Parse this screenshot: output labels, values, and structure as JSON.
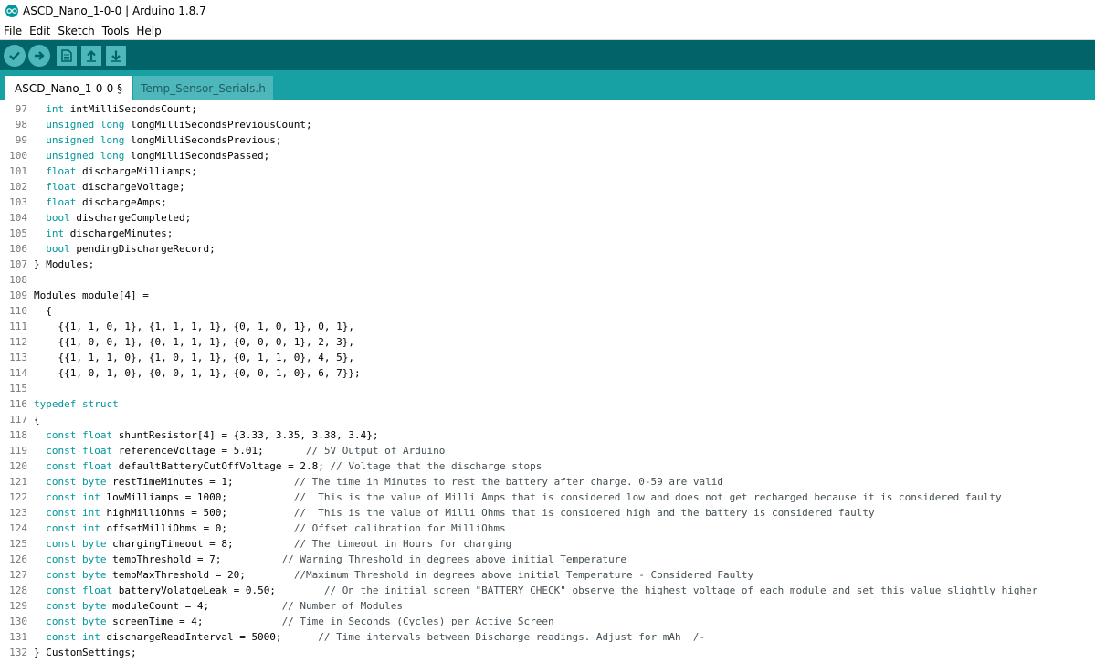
{
  "window": {
    "title": "ASCD_Nano_1-0-0 | Arduino 1.8.7"
  },
  "menu": [
    "File",
    "Edit",
    "Sketch",
    "Tools",
    "Help"
  ],
  "toolbar": [
    {
      "name": "verify-button",
      "icon": "check-icon"
    },
    {
      "name": "upload-button",
      "icon": "arrow-right-icon"
    },
    {
      "name": "new-button",
      "icon": "document-icon"
    },
    {
      "name": "open-button",
      "icon": "arrow-up-icon"
    },
    {
      "name": "save-button",
      "icon": "arrow-down-icon"
    }
  ],
  "tabs": [
    {
      "label": "ASCD_Nano_1-0-0 §",
      "active": true
    },
    {
      "label": "Temp_Sensor_Serials.h",
      "active": false
    }
  ],
  "colors": {
    "toolbar_bg": "#006468",
    "tabbar_bg": "#17a1a5",
    "keyword": "#00979c",
    "comment": "#434f54"
  },
  "code": [
    {
      "n": "97",
      "code": "  int intMilliSecondsCount;"
    },
    {
      "n": "98",
      "code": "  unsigned long longMilliSecondsPreviousCount;"
    },
    {
      "n": "99",
      "code": "  unsigned long longMilliSecondsPrevious;"
    },
    {
      "n": "100",
      "code": "  unsigned long longMilliSecondsPassed;"
    },
    {
      "n": "101",
      "code": "  float dischargeMilliamps;"
    },
    {
      "n": "102",
      "code": "  float dischargeVoltage;"
    },
    {
      "n": "103",
      "code": "  float dischargeAmps;"
    },
    {
      "n": "104",
      "code": "  bool dischargeCompleted;"
    },
    {
      "n": "105",
      "code": "  int dischargeMinutes;"
    },
    {
      "n": "106",
      "code": "  bool pendingDischargeRecord;"
    },
    {
      "n": "107",
      "code": "} Modules;"
    },
    {
      "n": "108",
      "code": ""
    },
    {
      "n": "109",
      "code": "Modules module[4] ="
    },
    {
      "n": "110",
      "code": "  {"
    },
    {
      "n": "111",
      "code": "    {{1, 1, 0, 1}, {1, 1, 1, 1}, {0, 1, 0, 1}, 0, 1},"
    },
    {
      "n": "112",
      "code": "    {{1, 0, 0, 1}, {0, 1, 1, 1}, {0, 0, 0, 1}, 2, 3},"
    },
    {
      "n": "113",
      "code": "    {{1, 1, 1, 0}, {1, 0, 1, 1}, {0, 1, 1, 0}, 4, 5},"
    },
    {
      "n": "114",
      "code": "    {{1, 0, 1, 0}, {0, 0, 1, 1}, {0, 0, 1, 0}, 6, 7}};"
    },
    {
      "n": "115",
      "code": ""
    },
    {
      "n": "116",
      "code": "typedef struct"
    },
    {
      "n": "117",
      "code": "{"
    },
    {
      "n": "118",
      "code": "  const float shuntResistor[4] = {3.33, 3.35, 3.38, 3.4};"
    },
    {
      "n": "119",
      "code": "  const float referenceVoltage = 5.01;       // 5V Output of Arduino"
    },
    {
      "n": "120",
      "code": "  const float defaultBatteryCutOffVoltage = 2.8; // Voltage that the discharge stops"
    },
    {
      "n": "121",
      "code": "  const byte restTimeMinutes = 1;          // The time in Minutes to rest the battery after charge. 0-59 are valid"
    },
    {
      "n": "122",
      "code": "  const int lowMilliamps = 1000;           //  This is the value of Milli Amps that is considered low and does not get recharged because it is considered faulty"
    },
    {
      "n": "123",
      "code": "  const int highMilliOhms = 500;           //  This is the value of Milli Ohms that is considered high and the battery is considered faulty"
    },
    {
      "n": "124",
      "code": "  const int offsetMilliOhms = 0;           // Offset calibration for MilliOhms"
    },
    {
      "n": "125",
      "code": "  const byte chargingTimeout = 8;          // The timeout in Hours for charging"
    },
    {
      "n": "126",
      "code": "  const byte tempThreshold = 7;          // Warning Threshold in degrees above initial Temperature"
    },
    {
      "n": "127",
      "code": "  const byte tempMaxThreshold = 20;        //Maximum Threshold in degrees above initial Temperature - Considered Faulty"
    },
    {
      "n": "128",
      "code": "  const float batteryVolatgeLeak = 0.50;        // On the initial screen \"BATTERY CHECK\" observe the highest voltage of each module and set this value slightly higher"
    },
    {
      "n": "129",
      "code": "  const byte moduleCount = 4;            // Number of Modules"
    },
    {
      "n": "130",
      "code": "  const byte screenTime = 4;             // Time in Seconds (Cycles) per Active Screen"
    },
    {
      "n": "131",
      "code": "  const int dischargeReadInterval = 5000;      // Time intervals between Discharge readings. Adjust for mAh +/-"
    },
    {
      "n": "132",
      "code": "} CustomSettings;"
    }
  ]
}
